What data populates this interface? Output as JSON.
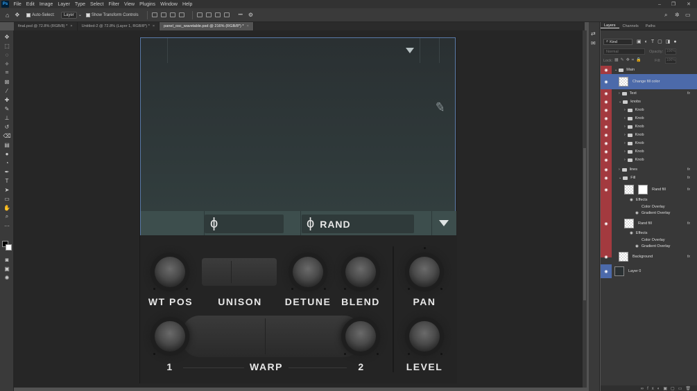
{
  "menu": [
    "File",
    "Edit",
    "Image",
    "Layer",
    "Type",
    "Select",
    "Filter",
    "View",
    "Plugins",
    "Window",
    "Help"
  ],
  "app_logo": "Ps",
  "options": {
    "auto_select_label": "Auto-Select:",
    "auto_select_value": "Layer",
    "transform_label": "Show Transform Controls",
    "more": "•••"
  },
  "tabs": [
    {
      "label": "final.psd @ 72.8% (RGB/8) *"
    },
    {
      "label": "Untitled-2 @ 72.8% (Layer 1, RGB/8*) *"
    },
    {
      "label": "panel_osc_wavetable.psd @ 216% (RGB/8*) *"
    }
  ],
  "synth": {
    "phase_symbol": "ϕ",
    "rand_label": "RAND",
    "knobs": {
      "wt_pos": "WT POS",
      "unison": "UNISON",
      "detune": "DETUNE",
      "blend": "BLEND",
      "pan": "PAN",
      "one": "1",
      "warp": "WARP",
      "two": "2",
      "level": "LEVEL"
    }
  },
  "layers_panel": {
    "tabs": [
      "Layers",
      "Channels",
      "Paths"
    ],
    "kind": "Kind",
    "blend_mode": "Normal",
    "opacity_label": "Opacity:",
    "opacity_value": "100%",
    "lock_label": "Lock:",
    "fill_label": "Fill:",
    "fill_value": "100%",
    "rows": [
      {
        "name": "Main"
      },
      {
        "name": "Change fill color"
      },
      {
        "name": "Text"
      },
      {
        "name": "knobs"
      },
      {
        "name": "Knob"
      },
      {
        "name": "Knob"
      },
      {
        "name": "Knob"
      },
      {
        "name": "Knob"
      },
      {
        "name": "Knob"
      },
      {
        "name": "Knob"
      },
      {
        "name": "Knob"
      },
      {
        "name": "lines"
      },
      {
        "name": "Fill"
      },
      {
        "name": "Rand fill"
      },
      {
        "name": "Effects"
      },
      {
        "name": "Color Overlay"
      },
      {
        "name": "Gradient Overlay"
      },
      {
        "name": "Rand fill"
      },
      {
        "name": "Effects"
      },
      {
        "name": "Color Overlay"
      },
      {
        "name": "Gradient Overlay"
      },
      {
        "name": "Background"
      },
      {
        "name": "Layer 0"
      }
    ],
    "fx": "fx"
  },
  "colors": {
    "selection_blue": "#4c6aaa",
    "eye_red": "#a33a3f",
    "accent": "#31a8ff"
  }
}
